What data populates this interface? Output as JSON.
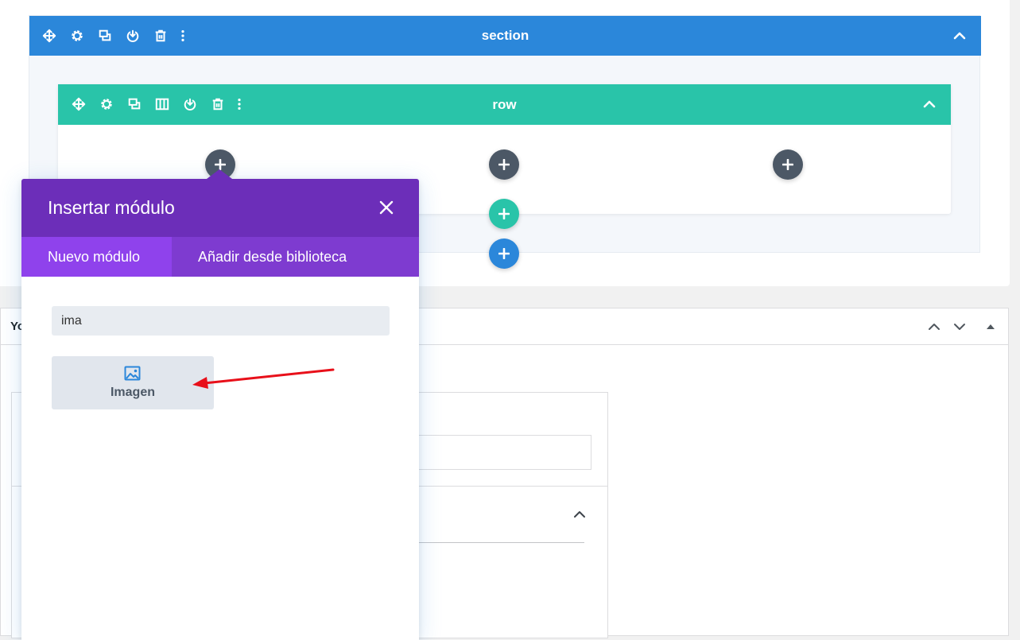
{
  "section": {
    "title": "section",
    "icons": [
      "move-icon",
      "settings-icon",
      "duplicate-icon",
      "save-icon",
      "delete-icon",
      "more-icon"
    ],
    "color": "#2b87da"
  },
  "row": {
    "title": "row",
    "icons": [
      "move-icon",
      "settings-icon",
      "duplicate-icon",
      "columns-icon",
      "save-icon",
      "delete-icon",
      "more-icon"
    ],
    "color": "#29c4a9"
  },
  "add_buttons": {
    "column_add": "+",
    "add_row": "+",
    "add_section": "+"
  },
  "modal": {
    "title": "Insertar módulo",
    "close_icon": "close-icon",
    "color": "#6c2eb9",
    "tabs": [
      {
        "label": "Nuevo módulo",
        "active": true
      },
      {
        "label": "Añadir desde biblioteca",
        "active": false
      }
    ],
    "search": {
      "value": "ima"
    },
    "modules": [
      {
        "label": "Imagen",
        "icon": "image-icon"
      }
    ]
  },
  "metabox": {
    "title": "Yo"
  },
  "annotation": {
    "arrow_color": "#e8101a"
  }
}
